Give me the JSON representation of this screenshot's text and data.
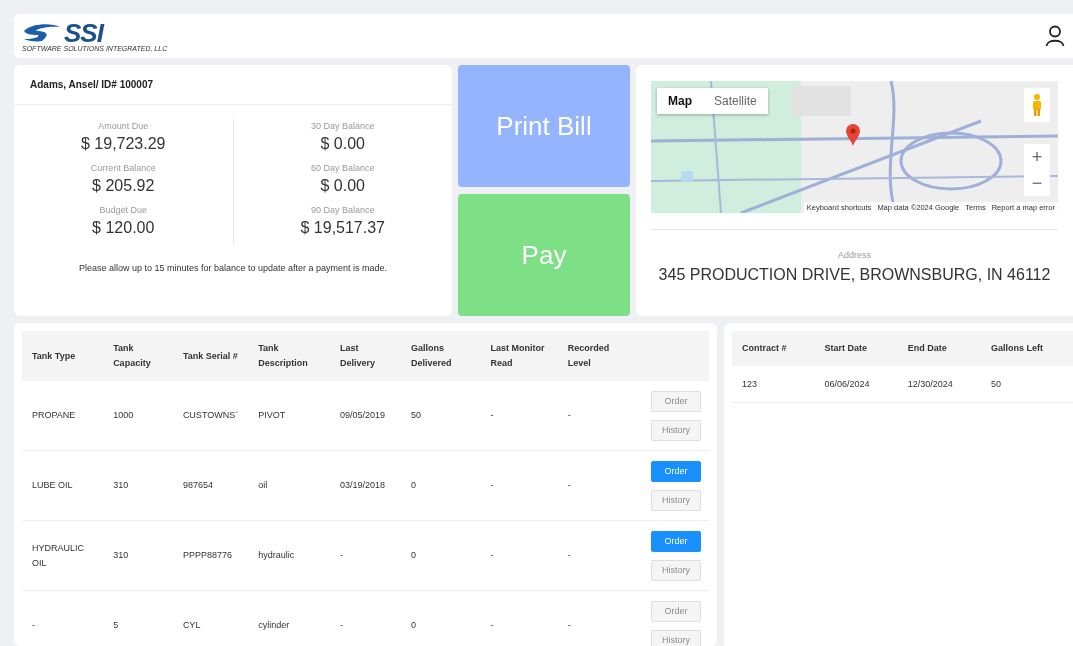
{
  "header": {
    "logo_text": "SSI",
    "logo_subtitle": "SOFTWARE SOLUTIONS INTEGRATED, LLC"
  },
  "account": {
    "title": "Adams, Ansel/ ID# 100007",
    "left": [
      {
        "label": "Amount Due",
        "value": "$ 19,723.29"
      },
      {
        "label": "Current Balance",
        "value": "$ 205.92"
      },
      {
        "label": "Budget Due",
        "value": "$ 120.00"
      }
    ],
    "right": [
      {
        "label": "30 Day Balance",
        "value": "$ 0.00"
      },
      {
        "label": "60 Day Balance",
        "value": "$ 0.00"
      },
      {
        "label": "90 Day Balance",
        "value": "$ 19,517.37"
      }
    ],
    "note": "Please allow up to 15 minutes for balance to update after a payment is made."
  },
  "actions": [
    {
      "label": "Print Bill",
      "kind": "print"
    },
    {
      "label": "Pay",
      "kind": "pay"
    }
  ],
  "map": {
    "tabs": [
      {
        "label": "Map",
        "selected": true
      },
      {
        "label": "Satellite",
        "selected": false
      }
    ],
    "zoom_in": "+",
    "zoom_out": "−",
    "attribution": [
      "Keyboard shortcuts",
      "Map data ©2024 Google",
      "Terms",
      "Report a map error"
    ],
    "address_label": "Address",
    "address": "345 PRODUCTION DRIVE, BROWNSBURG, IN 46112"
  },
  "tanks": {
    "columns": [
      "Tank Type",
      "Tank Capacity",
      "Tank Serial #",
      "Tank Description",
      "Last Delivery",
      "Gallons Delivered",
      "Last Monitor Read",
      "Recorded Level"
    ],
    "rows": [
      {
        "cells": [
          "PROPANE",
          "1000",
          "CUSTOWNS`",
          "PIVOT",
          "09/05/2019",
          "50",
          "-",
          "-"
        ],
        "order": "Order",
        "order_disabled": true,
        "history": "History",
        "history_disabled": true
      },
      {
        "cells": [
          "LUBE OIL",
          "310",
          "987654",
          "oil",
          "03/19/2018",
          "0",
          "-",
          "-"
        ],
        "order": "Order",
        "order_disabled": false,
        "history": "History",
        "history_disabled": true
      },
      {
        "cells": [
          "HYDRAULIC OIL",
          "310",
          "PPPP88776",
          "hydraulic",
          "-",
          "0",
          "-",
          "-"
        ],
        "order": "Order",
        "order_disabled": false,
        "history": "History",
        "history_disabled": true
      },
      {
        "cells": [
          "-",
          "5",
          "CYL",
          "cylinder",
          "-",
          "0",
          "-",
          "-"
        ],
        "order": "Order",
        "order_disabled": true,
        "history": "History",
        "history_disabled": true
      }
    ]
  },
  "contracts": {
    "columns": [
      "Contract #",
      "Start Date",
      "End Date",
      "Gallons Left"
    ],
    "rows": [
      {
        "cells": [
          "123",
          "06/06/2024",
          "12/30/2024",
          "50"
        ]
      }
    ]
  }
}
